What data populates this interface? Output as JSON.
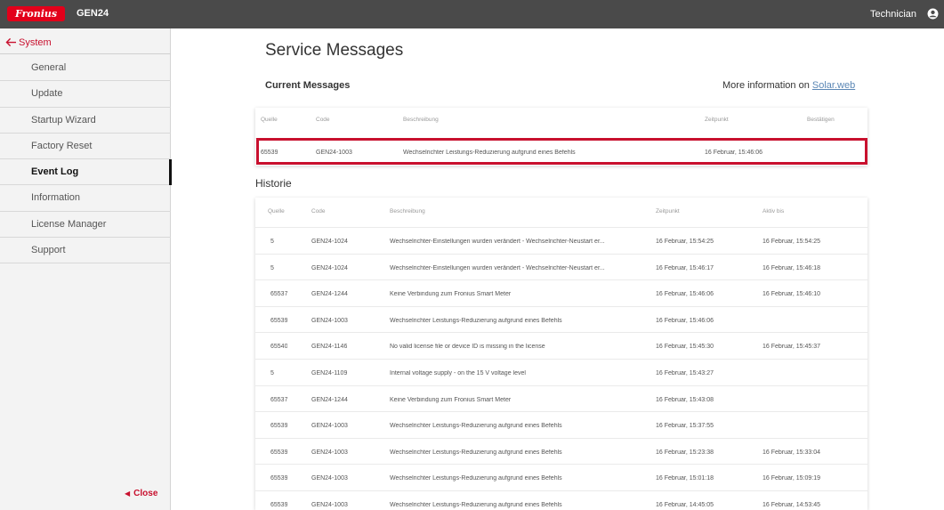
{
  "topbar": {
    "logo_text": "Fronius",
    "product": "GEN24",
    "role": "Technician",
    "user_icon": "user-circle-icon"
  },
  "sidebar": {
    "back_label": "System",
    "back_icon": "arrow-left-icon",
    "items": [
      {
        "label": "General"
      },
      {
        "label": "Update"
      },
      {
        "label": "Startup Wizard"
      },
      {
        "label": "Factory Reset"
      },
      {
        "label": "Event Log",
        "active": true
      },
      {
        "label": "Information"
      },
      {
        "label": "License Manager"
      },
      {
        "label": "Support"
      }
    ],
    "close_label": "Close"
  },
  "main": {
    "title": "Service Messages",
    "current_title": "Current Messages",
    "more_info_prefix": "More information on",
    "more_info_link": "Solar.web",
    "history_title": "Historie"
  },
  "current_table": {
    "headers": {
      "source": "Quelle",
      "code": "Code",
      "description": "Beschreibung",
      "time": "Zeitpunkt",
      "confirm": "Bestätigen"
    },
    "rows": [
      {
        "source": "65539",
        "code": "GEN24-1003",
        "description": "Wechselrichter Leistungs-Reduzierung aufgrund eines Befehls",
        "time": "16 Februar, 15:46:06"
      }
    ]
  },
  "history_table": {
    "headers": {
      "source": "Quelle",
      "code": "Code",
      "description": "Beschreibung",
      "time": "Zeitpunkt",
      "active_until": "Aktiv bis"
    },
    "rows": [
      {
        "source": "5",
        "code": "GEN24-1024",
        "description": "Wechselrichter-Einstellungen wurden verändert - Wechselrichter-Neustart er...",
        "time": "16 Februar, 15:54:25",
        "active_until": "16 Februar, 15:54:25"
      },
      {
        "source": "5",
        "code": "GEN24-1024",
        "description": "Wechselrichter-Einstellungen wurden verändert - Wechselrichter-Neustart er...",
        "time": "16 Februar, 15:46:17",
        "active_until": "16 Februar, 15:46:18"
      },
      {
        "source": "65537",
        "code": "GEN24-1244",
        "description": "Keine Verbindung zum Fronius Smart Meter",
        "time": "16 Februar, 15:46:06",
        "active_until": "16 Februar, 15:46:10"
      },
      {
        "source": "65539",
        "code": "GEN24-1003",
        "description": "Wechselrichter Leistungs-Reduzierung aufgrund eines Befehls",
        "time": "16 Februar, 15:46:06",
        "active_until": ""
      },
      {
        "source": "65540",
        "code": "GEN24-1146",
        "description": "No valid license file or device ID is missing in the license",
        "time": "16 Februar, 15:45:30",
        "active_until": "16 Februar, 15:45:37"
      },
      {
        "source": "5",
        "code": "GEN24-1109",
        "description": "Internal voltage supply - on the 15 V voltage level",
        "time": "16 Februar, 15:43:27",
        "active_until": ""
      },
      {
        "source": "65537",
        "code": "GEN24-1244",
        "description": "Keine Verbindung zum Fronius Smart Meter",
        "time": "16 Februar, 15:43:08",
        "active_until": ""
      },
      {
        "source": "65539",
        "code": "GEN24-1003",
        "description": "Wechselrichter Leistungs-Reduzierung aufgrund eines Befehls",
        "time": "16 Februar, 15:37:55",
        "active_until": ""
      },
      {
        "source": "65539",
        "code": "GEN24-1003",
        "description": "Wechselrichter Leistungs-Reduzierung aufgrund eines Befehls",
        "time": "16 Februar, 15:23:38",
        "active_until": "16 Februar, 15:33:04"
      },
      {
        "source": "65539",
        "code": "GEN24-1003",
        "description": "Wechselrichter Leistungs-Reduzierung aufgrund eines Befehls",
        "time": "16 Februar, 15:01:18",
        "active_until": "16 Februar, 15:09:19"
      },
      {
        "source": "65539",
        "code": "GEN24-1003",
        "description": "Wechselrichter Leistungs-Reduzierung aufgrund eines Befehls",
        "time": "16 Februar, 14:45:05",
        "active_until": "16 Februar, 14:53:45"
      }
    ]
  },
  "colors": {
    "brand_red": "#e2001a",
    "accent_red": "#c8102e",
    "topbar_bg": "#4a4a4a",
    "sidebar_bg": "#f3f3f3",
    "link_blue": "#5b87b5"
  }
}
